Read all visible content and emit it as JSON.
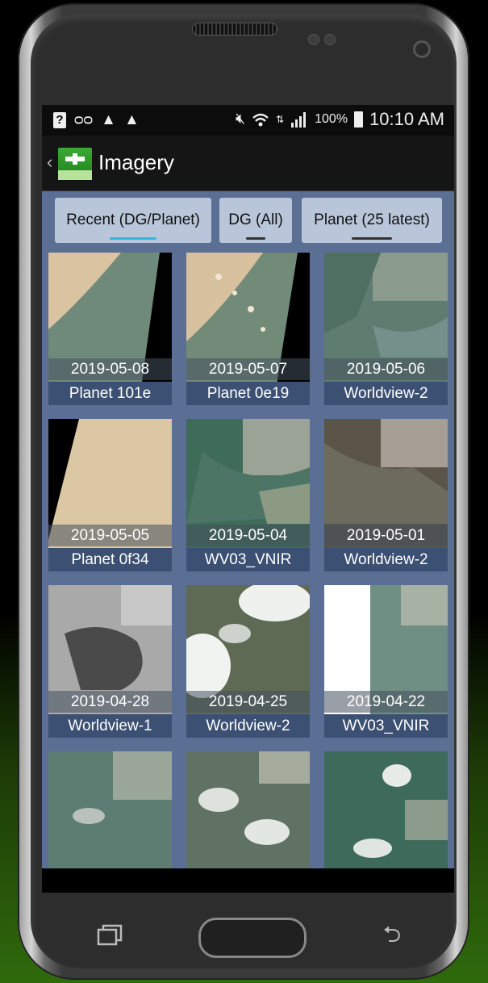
{
  "status_bar": {
    "left_icons": [
      "unknown-notification-icon",
      "voicemail-icon",
      "warning-icon",
      "warning-icon"
    ],
    "right_icons": [
      "mute-icon",
      "wifi-icon",
      "no-data-icon",
      "signal-icon"
    ],
    "battery": "100%",
    "time": "10:10 AM"
  },
  "action_bar": {
    "back_glyph": "‹",
    "title": "Imagery"
  },
  "tabs": [
    {
      "label": "Recent (DG/Planet)",
      "active": true
    },
    {
      "label": "DG (All)",
      "active": false
    },
    {
      "label": "Planet (25 latest)",
      "active": false
    }
  ],
  "tiles": [
    {
      "date": "2019-05-08",
      "sensor": "Planet 101e"
    },
    {
      "date": "2019-05-07",
      "sensor": "Planet 0e19"
    },
    {
      "date": "2019-05-06",
      "sensor": "Worldview-2"
    },
    {
      "date": "2019-05-05",
      "sensor": "Planet 0f34"
    },
    {
      "date": "2019-05-04",
      "sensor": "WV03_VNIR"
    },
    {
      "date": "2019-05-01",
      "sensor": "Worldview-2"
    },
    {
      "date": "2019-04-28",
      "sensor": "Worldview-1"
    },
    {
      "date": "2019-04-25",
      "sensor": "Worldview-2"
    },
    {
      "date": "2019-04-22",
      "sensor": "WV03_VNIR"
    }
  ],
  "colors": {
    "content_bg": "#5b6f95",
    "tab_bg": "#b9c6d9",
    "active_indicator": "#33b5e5",
    "sensor_label_bg": "#3c5073"
  }
}
